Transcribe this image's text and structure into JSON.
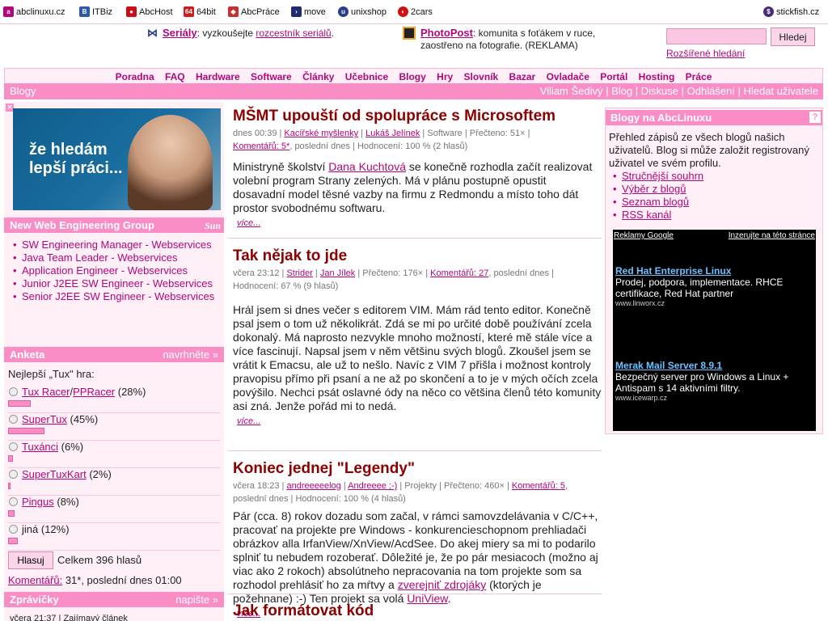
{
  "netbar": {
    "items": [
      {
        "label": "abclinuxu.cz",
        "icon": "abclinuxu-icon",
        "color": "#b2067a"
      },
      {
        "label": "ITBiz",
        "icon": "itbiz-icon",
        "color": "#2b5aa8"
      },
      {
        "label": "AbcHost",
        "icon": "abchost-icon",
        "color": "#c81018"
      },
      {
        "label": "64bit",
        "icon": "64bit-icon",
        "color": "#d01b1b"
      },
      {
        "label": "AbcPráce",
        "icon": "abcprace-icon",
        "color": "#c83030"
      },
      {
        "label": "move",
        "icon": "move-icon",
        "color": "#1f2d6e"
      },
      {
        "label": "unixshop",
        "icon": "unixshop-icon",
        "color": "#2b3d8a"
      },
      {
        "label": "2cars",
        "icon": "2cars-icon",
        "color": "#d01010"
      }
    ],
    "right": {
      "label": "stickfish.cz",
      "icon": "stickfish-icon",
      "color": "#4a2a7a"
    }
  },
  "header": {
    "serialy_title": "Seriály",
    "serialy_text_pre": ": vyzkoušejte ",
    "serialy_link": "rozcestník seriálů",
    "serialy_text_post": ".",
    "photopost_title": "PhotoPost",
    "photopost_text": ": komunita s foťákem v ruce, zaostřeno na fotografie. (REKLAMA)",
    "search_placeholder": "",
    "search_button": "Hledej",
    "advanced_search": "Rozšířené hledání"
  },
  "nav": {
    "items": [
      "Poradna",
      "FAQ",
      "Hardware",
      "Software",
      "Články",
      "Učebnice",
      "Blogy",
      "Hry",
      "Slovník",
      "Bazar",
      "Ovladače",
      "Portál",
      "Hosting",
      "Práce"
    ]
  },
  "subnav": {
    "section": "Blogy",
    "user": "Viliam Šedivý",
    "links": [
      "Blog",
      "Diskuse",
      "Odhlášení",
      "Hledat uživatele"
    ]
  },
  "left": {
    "banner_text_line1": "že hledám",
    "banner_text_line2": "lepší práci...",
    "jobs_title": "New Web Engineering Group",
    "jobs_logo": "Sun",
    "jobs": [
      "SW Engineering Manager - Webservices",
      "Java Team Leader - Webservices",
      "Application Engineer - Webservices",
      "Junior J2EE SW Engineer - Webservices",
      "Senior J2EE SW Engineer - Webservices"
    ],
    "poll_title": "Anketa",
    "poll_suggest": "navrhněte »",
    "poll_question": "Nejlepší „Tux\" hra:",
    "poll_options": [
      {
        "label_a": "Tux Racer",
        "sep": "/",
        "label_b": "PPRacer",
        "pct_text": " (28%)",
        "pct": 28
      },
      {
        "label_a": "SuperTux",
        "sep": "",
        "label_b": "",
        "pct_text": " (45%)",
        "pct": 45
      },
      {
        "label_a": "Tuxánci",
        "sep": "",
        "label_b": "",
        "pct_text": " (6%)",
        "pct": 6
      },
      {
        "label_a": "SuperTuxKart",
        "sep": "",
        "label_b": "",
        "pct_text": " (2%)",
        "pct": 2
      },
      {
        "label_a": "Pingus",
        "sep": "",
        "label_b": "",
        "pct_text": " (8%)",
        "pct": 8
      },
      {
        "label_a": "",
        "sep": "",
        "label_b": "",
        "plain": "jiná",
        "pct_text": " (12%)",
        "pct": 12
      }
    ],
    "poll_vote": "Hlasuj",
    "poll_total": "Celkem 396 hlasů",
    "poll_comments_link": "Komentářů:",
    "poll_comments_text": " 31*, poslední dnes 01:00",
    "news_title": "Zprávičky",
    "news_write": "napište »",
    "news_item": "včera 21:37 | Zajímavý článek"
  },
  "articles": [
    {
      "title": "MŠMT upouští od spolupráce s Microsoftem",
      "date": "dnes 00:39",
      "blog": "Kacířské myšlenky",
      "author": "Lukáš Jelínek",
      "category": "Software",
      "reads": "Přečteno: 51×",
      "comments": "Komentářů: 5*",
      "last": ", poslední dnes",
      "rating": "Hodnocení: 100 % (2 hlasů)",
      "body_pre": "Ministryně školství ",
      "body_link": "Dana Kuchtová",
      "body_post": " se konečně rozhodla začít realizovat volební program Strany zelených. Má v plánu postupně opustit dosavadní model těsné vazby na firmu z Redmondu a místo toho dát prostor svobodnému softwaru.",
      "more": "více..."
    },
    {
      "title": "Tak nějak to jde",
      "date": "včera 23:12",
      "blog": "Strider",
      "author": "Jan Jílek",
      "reads": "Přečteno: 176×",
      "comments": "Komentářů: 27",
      "last": ", poslední dnes",
      "rating": "Hodnocení: 67 % (9 hlasů)",
      "body": "Hrál jsem si dnes večer s editorem VIM. Mám rád tento editor. Konečně psal jsem o tom už několikrát. Zdá se mi po určité době používání zcela dokonalý. Má naprosto nezvykle mnoho možností, které mě stále více a více fascinují. Napsal jsem v něm většinu svých blogů. Zkoušel jsem se vrátit k Emacsu, ale už to nešlo. Navíc z VIM 7 přišla i možnost kontroly pravopisu přímo při psaní a ne až po skončení a to je v mých očích zcela povýšilo. Nechci psát oslavné ódy na něco co většina členů této komunity asi zná. Jenže pořád mi to nedá.",
      "more": "více..."
    },
    {
      "title": "Koniec jednej \"Legendy\"",
      "date": "včera 18:23",
      "blog": "andreeeeelog",
      "author": "Andreeee ;-)",
      "category": "Projekty",
      "reads": "Přečteno: 460×",
      "comments": "Komentářů: 5",
      "last": ", poslední dnes",
      "rating": "Hodnocení: 100 % (4 hlasů)",
      "body_pre": "Pár (cca. 8) rokov dozadu som začal, v rámci samovzdelávania v C/C++, pracovať na projekte pre Windows - konkurencieschopnom prehliadači obrázkov alla IrfanView/XnView/AcdSee. Do akej miery sa mi to podarilo splniť tu nebudem rozoberať. Dôležité je, že po pár mesiacoch (možno aj viac ako 2 rokoch) absolútneho nepracovania na tom projekte som sa rozhodol prehlásiť ho za mŕtvy a ",
      "body_link1": "zverejniť zdrojáky",
      "body_mid": " (ktorých je požehnane) :-) Ten projekt sa volá ",
      "body_link2": "UniView",
      "body_end": ".",
      "more": "více..."
    },
    {
      "title": "Jak formátovat kód"
    }
  ],
  "right": {
    "title": "Blogy na AbcLinuxu",
    "help": "?",
    "intro": "Přehled zápisů ze všech blogů našich uživatelů. Blog si může založit registrovaný uživatel ve svém profilu.",
    "links": [
      "Stručnější souhrn",
      "Výběr z blogů",
      "Seznam blogů",
      "RSS kanál"
    ],
    "ads_label": "Reklamy Google",
    "ads_right": "Inzerujte na této stránce",
    "ads": [
      {
        "title": "Red Hat Enterprise Linux",
        "desc": "Prodej, podpora, implementace. RHCE certifikace, Red Hat partner",
        "url": "www.linworx.cz"
      },
      {
        "title": "Merak Mail Server 8.9.1",
        "desc": "Bezpečný server pro Windows a Linux + Antispam s 14 aktivními filtry.",
        "url": "www.icewarp.cz"
      }
    ]
  },
  "colors": {
    "accent": "#fa8cc6",
    "link": "#b2067a",
    "title": "#8b0000",
    "panel": "#fff0f8"
  }
}
